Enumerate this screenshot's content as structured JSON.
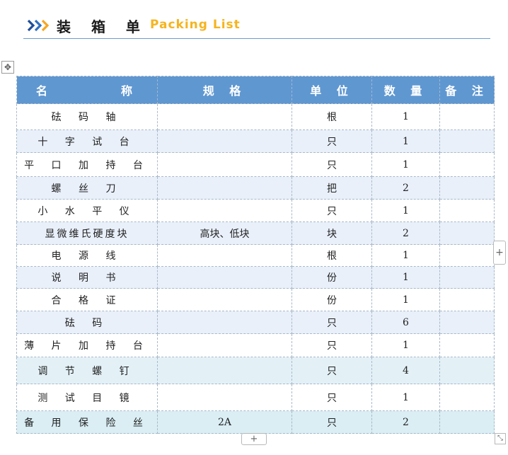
{
  "title": {
    "cn": "装 箱 单",
    "en": "Packing List"
  },
  "columns": [
    "名　　　　称",
    "规 格",
    "单 位",
    "数 量",
    "备 注"
  ],
  "rows": [
    {
      "name": "砝 码 轴",
      "spec": "",
      "unit": "根",
      "qty": "1",
      "note": ""
    },
    {
      "name": "十 字 试 台",
      "spec": "",
      "unit": "只",
      "qty": "1",
      "note": ""
    },
    {
      "name": "平 口 加 持 台",
      "spec": "",
      "unit": "只",
      "qty": "1",
      "note": ""
    },
    {
      "name": "螺 丝 刀",
      "spec": "",
      "unit": "把",
      "qty": "2",
      "note": ""
    },
    {
      "name": "小 水 平 仪",
      "spec": "",
      "unit": "只",
      "qty": "1",
      "note": ""
    },
    {
      "name": "显微维氏硬度块",
      "spec": "高块、低块",
      "unit": "块",
      "qty": "2",
      "note": ""
    },
    {
      "name": "电 源 线",
      "spec": "",
      "unit": "根",
      "qty": "1",
      "note": ""
    },
    {
      "name": "说 明 书",
      "spec": "",
      "unit": "份",
      "qty": "1",
      "note": ""
    },
    {
      "name": "合 格 证",
      "spec": "",
      "unit": "份",
      "qty": "1",
      "note": ""
    },
    {
      "name": "砝 码",
      "spec": "",
      "unit": "只",
      "qty": "6",
      "note": ""
    },
    {
      "name": "薄 片 加 持 台",
      "spec": "",
      "unit": "只",
      "qty": "1",
      "note": ""
    },
    {
      "name": "调 节 螺 钉",
      "spec": "",
      "unit": "只",
      "qty": "4",
      "note": ""
    },
    {
      "name": "测 试 目 镜",
      "spec": "",
      "unit": "只",
      "qty": "1",
      "note": ""
    },
    {
      "name": "备 用 保 险 丝",
      "spec": "2A",
      "unit": "只",
      "qty": "2",
      "note": ""
    }
  ],
  "icons": {
    "move": "move-cross-icon",
    "add_column": "plus-icon",
    "add_row": "plus-icon",
    "resize": "resize-diagonal-icon"
  },
  "colors": {
    "header_bg": "#5f97d1",
    "row_alt": "#e9f0fa",
    "row_highlight": "#e3f1f7",
    "title_accent": "#f5b41f",
    "chevron": "#1f4e9a"
  }
}
